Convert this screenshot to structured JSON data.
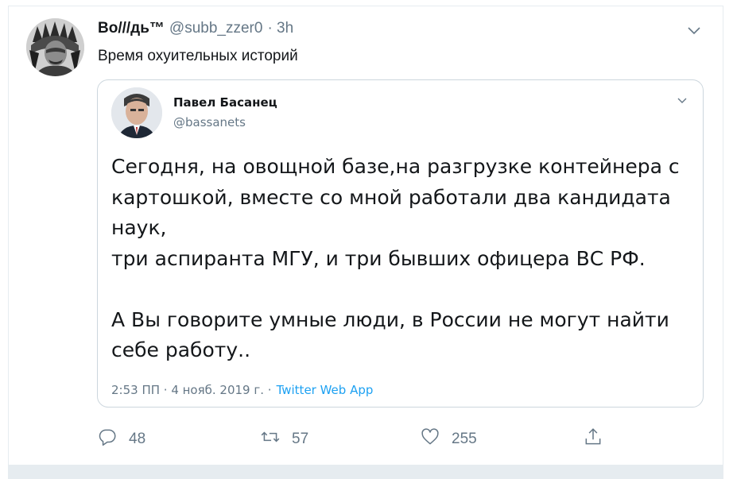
{
  "tweet": {
    "display_name": "Во///дь™",
    "handle": "@subb_zzer0",
    "time": "· 3h",
    "text": "Время охуительных историй",
    "menu_icon": "chevron-down-icon"
  },
  "quoted_tweet": {
    "name": "Павел Басанец",
    "handle": "@bassanets",
    "text": "Сегодня, на овощной базе,на разгрузке контейнера с\nкартошкой, вместе со мной работали два кандидата\nнаук,\nтри аспиранта МГУ, и три бывших офицера ВС РФ.\n\nА Вы говорите умные люди, в России не могут найти\nсебе работу..",
    "timestamp": "2:53 ПП · 4 нояб. 2019 г. ·",
    "source": "Twitter Web App"
  },
  "actions": {
    "reply_count": "48",
    "retweet_count": "57",
    "like_count": "255"
  },
  "colors": {
    "accent": "#1da1f2",
    "muted": "#657786",
    "border": "#ccd6dd"
  }
}
